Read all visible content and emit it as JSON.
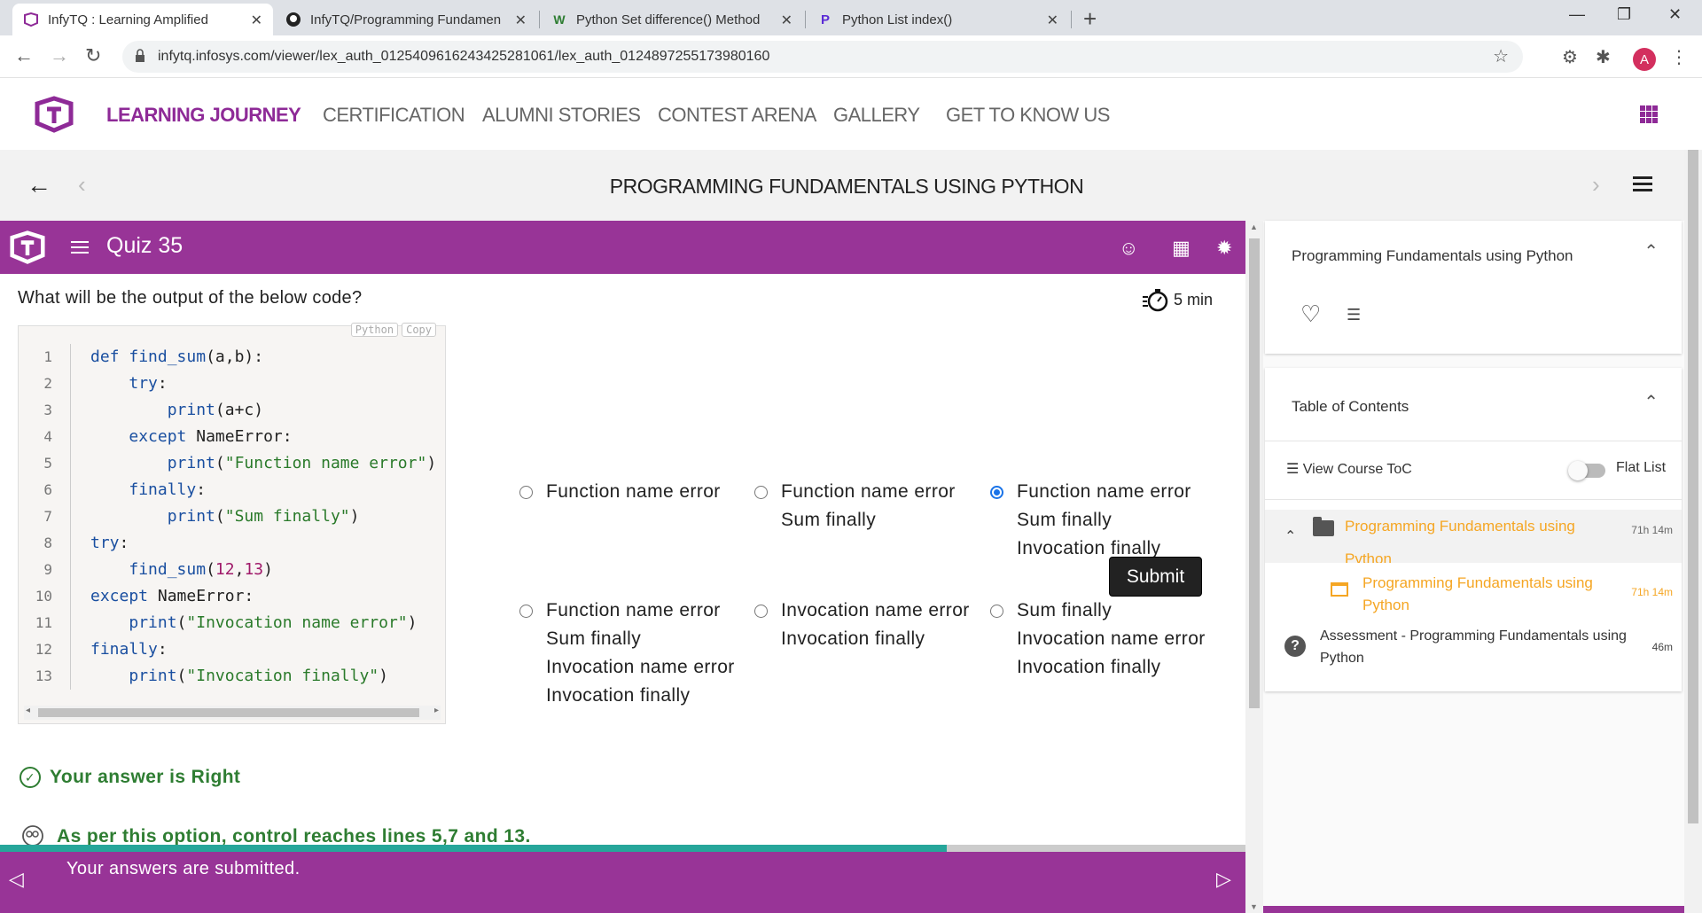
{
  "browser": {
    "tabs": [
      {
        "title": "InfyTQ : Learning Amplified",
        "active": true
      },
      {
        "title": "InfyTQ/Programming Fundamen",
        "active": false
      },
      {
        "title": "Python Set difference() Method",
        "active": false
      },
      {
        "title": "Python List index()",
        "active": false
      }
    ],
    "url": "infytq.infosys.com/viewer/lex_auth_01254096162434252810​61/lex_auth_0124897255173980160",
    "profile_initial": "A"
  },
  "site_nav": {
    "items": [
      "LEARNING JOURNEY",
      "CERTIFICATION",
      "ALUMNI STORIES",
      "CONTEST ARENA",
      "GALLERY",
      "GET TO KNOW US"
    ],
    "active_color": "#8e2a97"
  },
  "course": {
    "title": "PROGRAMMING FUNDAMENTALS USING PYTHON"
  },
  "quiz": {
    "title": "Quiz 35",
    "question": "What will be the output of the below code?",
    "timer": "5 min",
    "code_lang": "Python",
    "code_copy": "Copy",
    "code_lines": [
      "def find_sum(a,b):",
      "    try:",
      "        print(a+c)",
      "    except NameError:",
      "        print(\"Function name error\")",
      "    finally:",
      "        print(\"Sum finally\")",
      "try:",
      "    find_sum(12,13)",
      "except NameError:",
      "    print(\"Invocation name error\")",
      "finally:",
      "    print(\"Invocation finally\")"
    ],
    "options": [
      {
        "lines": [
          "Function name error"
        ],
        "selected": false
      },
      {
        "lines": [
          "Function name error",
          "Sum finally"
        ],
        "selected": false
      },
      {
        "lines": [
          "Function name error",
          "Sum finally",
          "Invocation finally"
        ],
        "selected": true
      },
      {
        "lines": [
          "Function name error",
          "Sum finally",
          "Invocation name error",
          "Invocation finally"
        ],
        "selected": false
      },
      {
        "lines": [
          "Invocation name error",
          "Invocation finally"
        ],
        "selected": false
      },
      {
        "lines": [
          "Sum finally",
          "Invocation name error",
          "Invocation finally"
        ],
        "selected": false
      }
    ],
    "submit_label": "Submit",
    "verdict": "Your answer is Right",
    "explanation": "As per this option, control reaches lines 5,7 and 13.",
    "footer_message": "Your answers are submitted.",
    "progress_fraction": 0.76,
    "theme_color": "#983497"
  },
  "sidebar": {
    "course_card_title": "Programming Fundamentals using Python",
    "toc_title": "Table of Contents",
    "view_toc": "View Course ToC",
    "flat_list": "Flat List",
    "toc_items": [
      {
        "label": "Programming Fundamentals using Python",
        "duration": "71h 14m"
      },
      {
        "label": "Programming Fundamentals using Python",
        "duration": "71h 14m"
      },
      {
        "label": "Assessment - Programming Fundamentals using Python",
        "duration": "46m"
      }
    ]
  }
}
